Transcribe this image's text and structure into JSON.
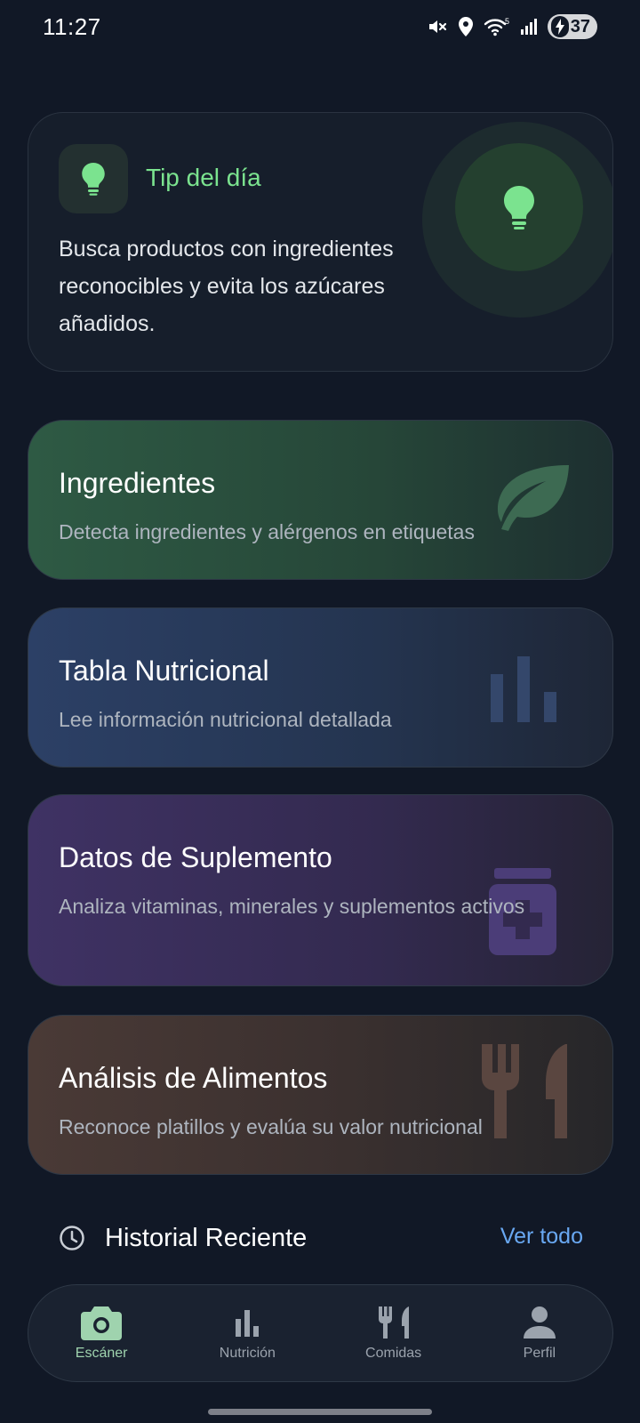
{
  "status_bar": {
    "time": "11:27",
    "battery": "37",
    "icons": [
      "mute-icon",
      "location-icon",
      "wifi-icon",
      "signal-icon",
      "battery-charging-icon"
    ]
  },
  "tip": {
    "title": "Tip del día",
    "text": "Busca productos con ingredientes reconocibles y evita los azúcares añadidos.",
    "icon": "lightbulb-icon",
    "accent": "#7be38f"
  },
  "features": [
    {
      "title": "Ingredientes",
      "description": "Detecta ingredientes y alérgenos en etiquetas",
      "icon": "leaf-icon"
    },
    {
      "title": "Tabla Nutricional",
      "description": "Lee información nutricional detallada",
      "icon": "bar-chart-icon"
    },
    {
      "title": "Datos de Suplemento",
      "description": "Analiza vitaminas, minerales y suplementos activos",
      "icon": "medicine-icon"
    },
    {
      "title": "Análisis de Alimentos",
      "description": "Reconoce platillos y evalúa su valor nutricional",
      "icon": "utensils-icon"
    }
  ],
  "historial": {
    "title": "Historial Reciente",
    "link": "Ver todo",
    "icon": "clock-icon",
    "link_color": "#69a8f2"
  },
  "nav": {
    "active_index": 0,
    "items": [
      {
        "label": "Escáner",
        "icon": "camera-icon"
      },
      {
        "label": "Nutrición",
        "icon": "bar-chart-icon"
      },
      {
        "label": "Comidas",
        "icon": "utensils-icon"
      },
      {
        "label": "Perfil",
        "icon": "person-icon"
      }
    ]
  }
}
